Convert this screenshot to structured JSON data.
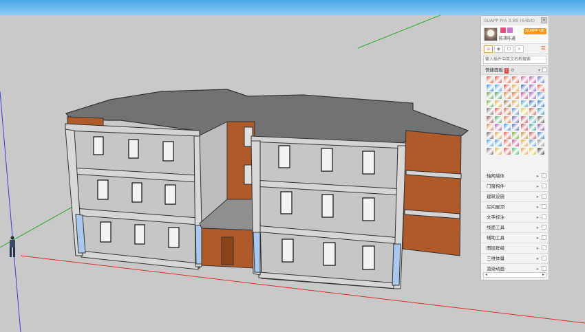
{
  "panel": {
    "title": "SUAPP Pro 3.86 (64bit)",
    "close_icon": "×",
    "user_name": "陈琪咔通",
    "vip_label": "SUAPP UB",
    "search_placeholder": "输入插件中英文名称搜索",
    "quick_label": "快捷面板",
    "quick_count": "1",
    "categories": [
      {
        "label": "轴网墙体"
      },
      {
        "label": "门窗构件"
      },
      {
        "label": "建筑设施"
      },
      {
        "label": "房间屋顶"
      },
      {
        "label": "文字标注"
      },
      {
        "label": "线面工具"
      },
      {
        "label": "辅助工具"
      },
      {
        "label": "图层群组"
      },
      {
        "label": "三维体量"
      },
      {
        "label": "渲染动画"
      }
    ],
    "scroll_left": "◂",
    "scroll_right": "▸",
    "tool_colors": [
      "#e84a3a",
      "#e84a3a",
      "#f06040",
      "#e0523a",
      "#d94c8f",
      "#c04a9a",
      "#4a6fd6",
      "#2b8ad9",
      "#3aa0e0",
      "#d64040",
      "#e8a030",
      "#2a60c0",
      "#8a5ad0",
      "#e84a3a",
      "#5aa040",
      "#3a9a50",
      "#d08030",
      "#e06a30",
      "#c04090",
      "#a050c0",
      "#3080e0",
      "#6ab04a",
      "#e0a040",
      "#8a6a40",
      "#d0a030",
      "#40a0c0",
      "#3060b0",
      "#2070d0",
      "#707070",
      "#e84040",
      "#c06030",
      "#4a8ad0",
      "#e0c030",
      "#e05030",
      "#2a90c0",
      "#a04040",
      "#40a060",
      "#e07030",
      "#6050c0",
      "#c04060",
      "#3aa0a0",
      "#505050",
      "#e08040",
      "#9a50b0",
      "#2a8ae0",
      "#4a60c0",
      "#d04040",
      "#30a090",
      "#8040a0",
      "#606060",
      "#d0a040",
      "#e84a3a",
      "#70a030",
      "#c09030",
      "#c05050",
      "#3070c0",
      "#40a0e0",
      "#3090d0",
      "#e06040",
      "#c04080",
      "#e0a030",
      "#4a90d0",
      "#8a8a8a",
      "#6a6a6a",
      "#e0b030",
      "#d04040",
      "#40b060",
      "#e0a040",
      "#e0c030",
      "#303030"
    ]
  }
}
